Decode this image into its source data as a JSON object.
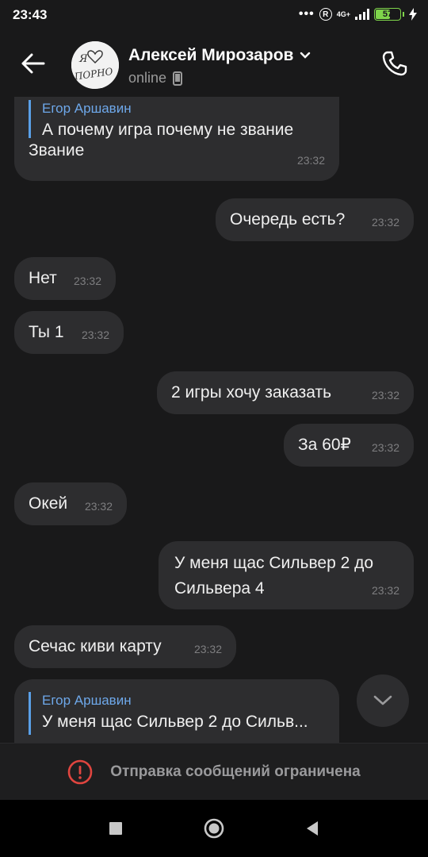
{
  "status_bar": {
    "time": "23:43",
    "dots": "•••",
    "r_badge": "R",
    "network": "4G+",
    "battery": "57",
    "battery_level": 0.57
  },
  "header": {
    "contact_name": "Алексей Мирозаров",
    "status": "online",
    "avatar_text_top": "Я",
    "avatar_text_bottom": "ПОРНО"
  },
  "messages": [
    {
      "side": "in",
      "reply_author": "Егор Аршавин",
      "reply_text": "А почему игра почему не звание",
      "text": "Звание",
      "time": "23:32"
    },
    {
      "side": "out",
      "text": "Очередь есть?",
      "time": "23:32"
    },
    {
      "side": "in",
      "text": "Нет",
      "time": "23:32"
    },
    {
      "side": "in",
      "text": "Ты 1",
      "time": "23:32"
    },
    {
      "side": "out",
      "text": "2 игры хочу заказать",
      "time": "23:32"
    },
    {
      "side": "out",
      "text": "За 60₽",
      "time": "23:32"
    },
    {
      "side": "in",
      "text": "Окей",
      "time": "23:32"
    },
    {
      "side": "out",
      "text_line1": "У меня щас Сильвер 2 до",
      "text_line2": "Сильвера 4",
      "time": "23:32"
    },
    {
      "side": "in",
      "text": "Сечас киви карту",
      "time": "23:32"
    },
    {
      "side": "in",
      "reply_author": "Егор Аршавин",
      "reply_text": "У меня щас Сильвер 2 до Сильв..."
    }
  ],
  "restriction": {
    "text": "Отправка сообщений ограничена"
  },
  "colors": {
    "background": "#19191a",
    "bubble": "#2d2d2f",
    "accent": "#5aa0e8",
    "warning": "#e0453f"
  }
}
